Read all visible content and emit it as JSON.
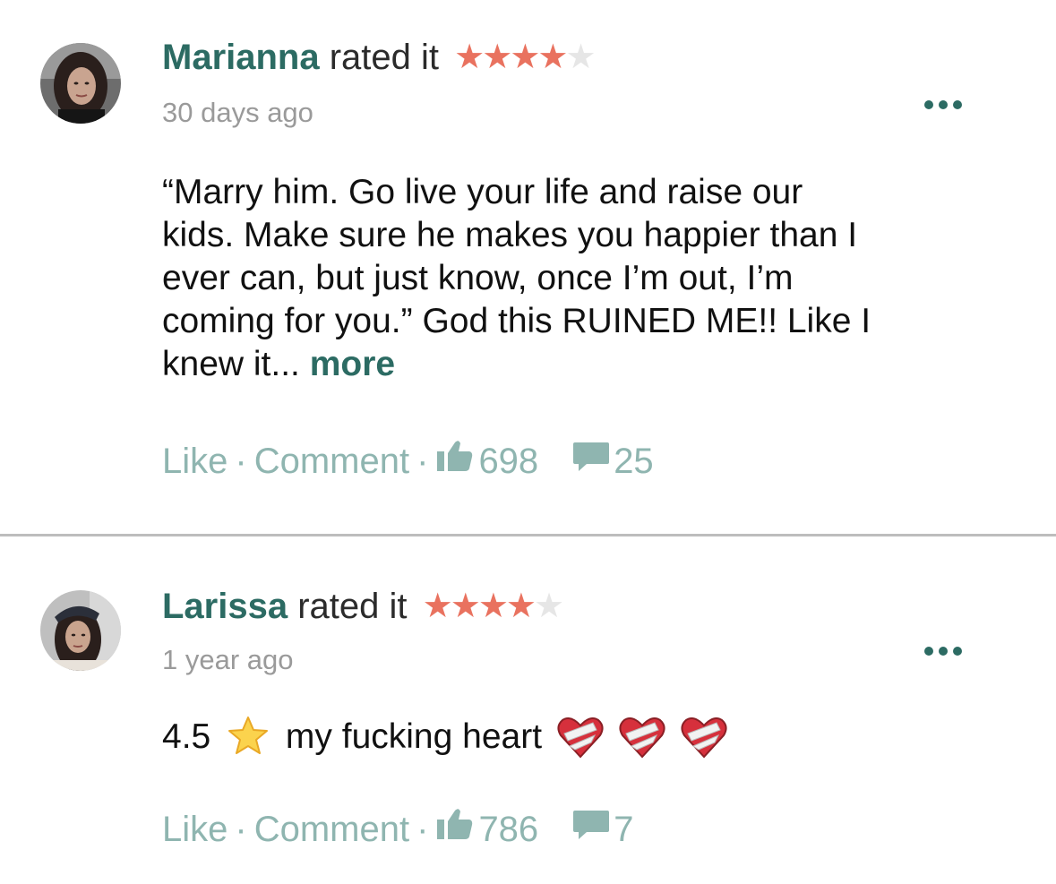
{
  "reviews": [
    {
      "name": "Marianna",
      "rated_text": "rated it",
      "rating": 4,
      "rating_max": 5,
      "time_ago": "30 days ago",
      "body": "“Marry him. Go live your life and raise our kids. Make sure he makes you happier than I ever can, but just know, once I’m out, I’m coming for you.”  God this RUINED ME!! Like I knew it...",
      "more_label": "more",
      "like_label": "Like",
      "comment_label": "Comment",
      "separator": "·",
      "likes": "698",
      "comments": "25"
    },
    {
      "name": "Larissa",
      "rated_text": "rated it",
      "rating": 4,
      "rating_max": 5,
      "time_ago": "1 year ago",
      "body_prefix": "4.5",
      "body_text": "my fucking heart",
      "like_label": "Like",
      "comment_label": "Comment",
      "separator": "·",
      "likes": "786",
      "comments": "7"
    }
  ],
  "icons": {
    "menu": "more-horizontal-icon",
    "like": "thumbs-up-icon",
    "comment": "speech-bubble-icon",
    "emoji_star": "glowing-star-emoji",
    "emoji_heart": "mending-heart-emoji"
  },
  "colors": {
    "brand": "#2c6b63",
    "star_on": "#e9725f",
    "star_off": "#e6e6e6",
    "muted": "#9a9a9a",
    "action": "#8fb5b0",
    "divider": "#bdbdbd"
  }
}
